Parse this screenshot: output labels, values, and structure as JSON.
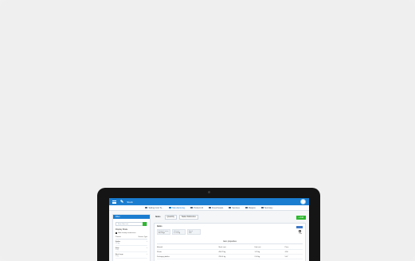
{
  "app": {
    "logo": "✎",
    "title": "Stock"
  },
  "nav": [
    {
      "label": "Selling Cost Te...",
      "active": false
    },
    {
      "label": "Manufacturing",
      "active": true
    },
    {
      "label": "Product 24",
      "active": false
    },
    {
      "label": "Fixed Assets",
      "active": false
    },
    {
      "label": "Services",
      "active": false
    },
    {
      "label": "Margins",
      "active": false
    },
    {
      "label": "Summary",
      "active": false
    }
  ],
  "sidebar": {
    "header": "Filter",
    "search_placeholder": "Enter filter text",
    "section_label": "Display Mode",
    "checkbox_label": "Hide already saved items",
    "tabs": [
      "Product",
      "Service Type"
    ],
    "rows": [
      {
        "name": "Bottles",
        "sub": "12 kg"
      },
      {
        "name": "Bags",
        "sub": "3 kg"
      },
      {
        "name": "Bins Large",
        "sub": "5 kg"
      }
    ]
  },
  "main": {
    "tabs": [
      "Items",
      "Quantity",
      "Sales Deliveries"
    ],
    "add_button": "+ Add",
    "panel": {
      "title": "Items",
      "fields": [
        {
          "label": "Product name",
          "value": "Bin Bags"
        },
        {
          "label": "Unit size",
          "value": "1 x 50 kg"
        },
        {
          "label": "Batch",
          "value": "100"
        }
      ],
      "side_label": "Edit",
      "section_title": "Item properties",
      "rows": [
        [
          "Material",
          "Stock cost",
          "Unit cost",
          "Price"
        ],
        [
          "Plastic",
          "456.78 kg",
          "1.23 kg",
          "4.56"
        ],
        [
          "Packaging bottles",
          "789.01 kg",
          "2.34 kg",
          "5.67"
        ]
      ]
    }
  },
  "colors": {
    "accent": "#1a7dd0",
    "success": "#2eb82e",
    "bezel": "#151515",
    "background": "#efefef"
  }
}
